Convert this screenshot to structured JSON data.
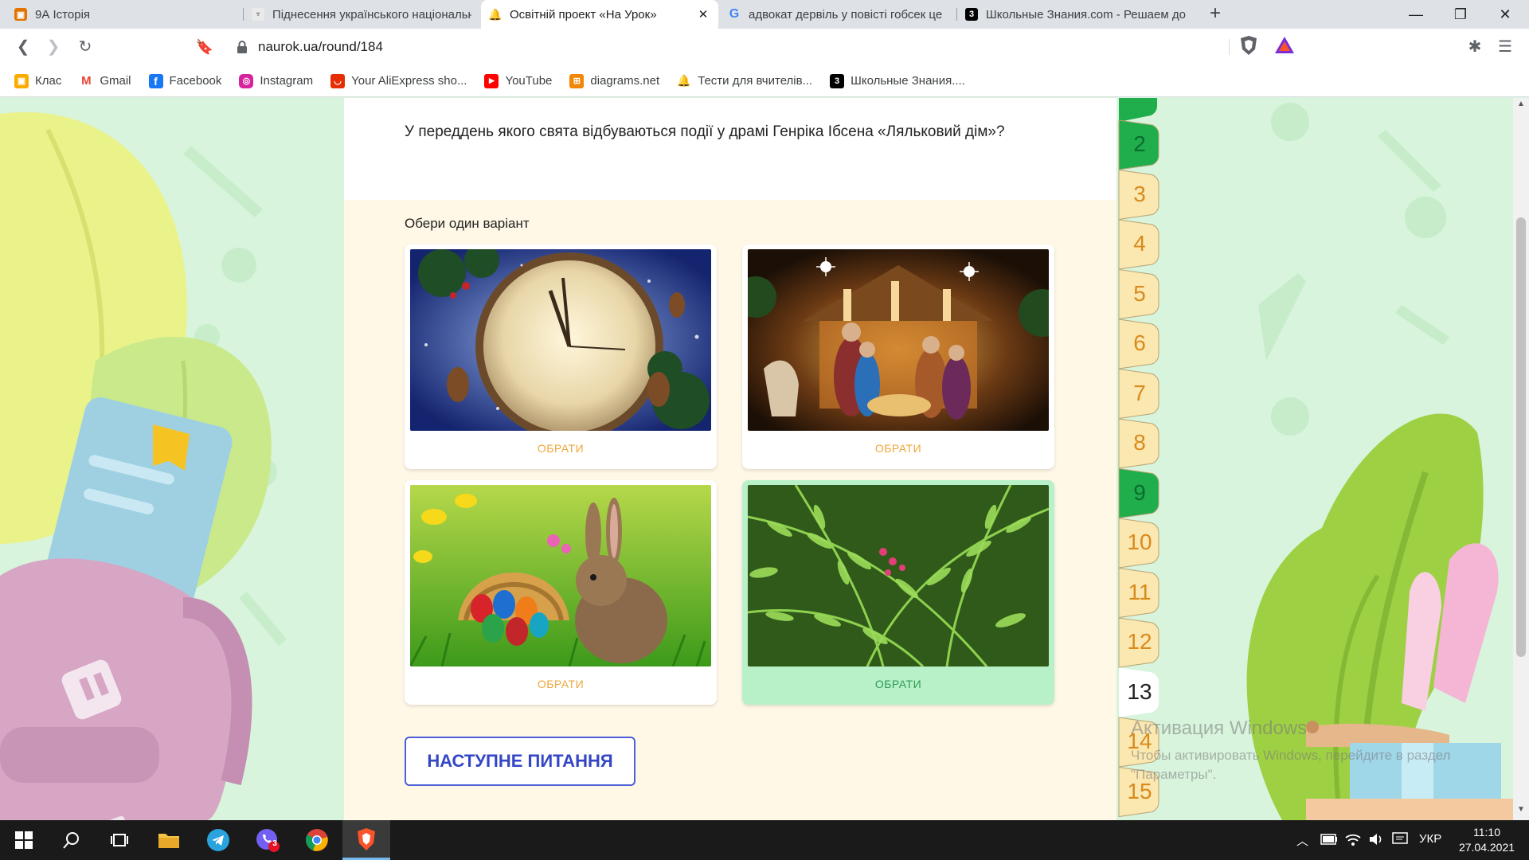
{
  "browser": {
    "tabs": [
      {
        "title": "9А Історія",
        "icon": "google-classroom-icon",
        "color": "#e37400",
        "active": false
      },
      {
        "title": "Піднесення українського національного",
        "icon": "lamp-icon",
        "color": "#ffffff",
        "active": false
      },
      {
        "title": "Освітній проект «На Урок»",
        "icon": "naurok-bell-icon",
        "color": "#f5a623",
        "active": true
      },
      {
        "title": "адвокат дервіль у повісті гобсек це",
        "icon": "google-icon",
        "color": "#4285f4",
        "active": false
      },
      {
        "title": "Школьные Знания.com - Решаем до",
        "icon": "znanija-icon",
        "color": "#000000",
        "active": false
      }
    ],
    "url": "naurok.ua/round/184",
    "bookmarks": [
      {
        "label": "Клас",
        "icon": "google-classroom-icon",
        "color": "#f9ab00"
      },
      {
        "label": "Gmail",
        "icon": "gmail-icon",
        "color": "#ea4335"
      },
      {
        "label": "Facebook",
        "icon": "facebook-icon",
        "color": "#1877f2"
      },
      {
        "label": "Instagram",
        "icon": "instagram-icon",
        "color": "#d6249f"
      },
      {
        "label": "Your AliExpress sho...",
        "icon": "aliexpress-icon",
        "color": "#e62e04"
      },
      {
        "label": "YouTube",
        "icon": "youtube-icon",
        "color": "#ff0000"
      },
      {
        "label": "diagrams.net",
        "icon": "diagrams-icon",
        "color": "#f08705"
      },
      {
        "label": "Тести для вчителів...",
        "icon": "naurok-bell-icon",
        "color": "#f5a623"
      },
      {
        "label": "Школьные Знания....",
        "icon": "znanija-icon",
        "color": "#000000"
      }
    ]
  },
  "quiz": {
    "question": "У переддень якого свята відбуваються події у драмі Генріка Ібсена «Ляльковий дім»?",
    "prompt": "Обери один варіант",
    "options": [
      {
        "label": "ОБРАТИ",
        "image": "clock-with-christmas-decorations",
        "selected": false
      },
      {
        "label": "ОБРАТИ",
        "image": "nativity-scene",
        "selected": false
      },
      {
        "label": "ОБРАТИ",
        "image": "easter-bunny-with-eggs",
        "selected": false
      },
      {
        "label": "ОБРАТИ",
        "image": "fern-with-flowers",
        "selected": true
      }
    ],
    "next_button": "НАСТУПНЕ ПИТАННЯ"
  },
  "progress": {
    "numbers": [
      "2",
      "3",
      "4",
      "5",
      "6",
      "7",
      "8",
      "9",
      "10",
      "11",
      "12",
      "13",
      "14",
      "15"
    ],
    "completed": [
      "2",
      "9"
    ],
    "current": "13"
  },
  "watermark": {
    "title": "Активация Windows",
    "text": "Чтобы активировать Windows, перейдите в раздел \"Параметры\"."
  },
  "taskbar": {
    "language": "УКР",
    "time": "11:10",
    "date": "27.04.2021",
    "viber_badge": "3"
  }
}
